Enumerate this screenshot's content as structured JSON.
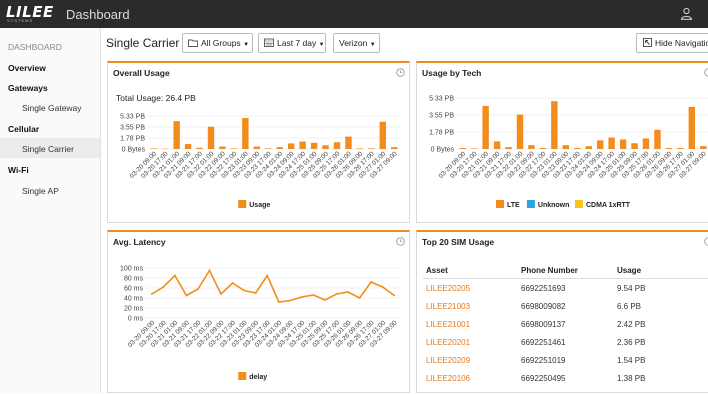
{
  "brand": {
    "logo_text": "LILEE",
    "logo_sub": "SYSTEMS",
    "app_title": "Dashboard"
  },
  "sidebar": {
    "header": "DASHBOARD",
    "items": [
      {
        "label": "Overview",
        "kind": "cat"
      },
      {
        "label": "Gateways",
        "kind": "cat"
      },
      {
        "label": "Single Gateway",
        "kind": "item"
      },
      {
        "label": "Cellular",
        "kind": "cat"
      },
      {
        "label": "Single Carrier",
        "kind": "item",
        "active": true
      },
      {
        "label": "Wi-Fi",
        "kind": "cat"
      },
      {
        "label": "Single AP",
        "kind": "item"
      }
    ]
  },
  "toolbar": {
    "page_title": "Single Carrier",
    "groups": "All Groups",
    "range": "Last 7 day",
    "carrier": "Verizon",
    "hide_nav": "Hide Navigation"
  },
  "colors": {
    "orange": "#f28c1c",
    "blue": "#2aa7e0",
    "yellow": "#f7c51d",
    "accent": "#ef8a20"
  },
  "overall": {
    "title": "Overall Usage",
    "total_label": "Total Usage: 26.4 PB"
  },
  "tech": {
    "title": "Usage by Tech"
  },
  "latency": {
    "title": "Avg. Latency"
  },
  "sims": {
    "title": "Top 20 SIM Usage",
    "columns": [
      "Asset",
      "Phone Number",
      "Usage"
    ],
    "rows": [
      {
        "asset": "LILEE20205",
        "phone": "6692251693",
        "usage": "9.54 PB"
      },
      {
        "asset": "LILEE21003",
        "phone": "6698009082",
        "usage": "6.6 PB"
      },
      {
        "asset": "LILEE21001",
        "phone": "6698009137",
        "usage": "2.42 PB"
      },
      {
        "asset": "LILEE20201",
        "phone": "6692251461",
        "usage": "2.36 PB"
      },
      {
        "asset": "LILEE20209",
        "phone": "6692251019",
        "usage": "1.54 PB"
      },
      {
        "asset": "LILEE20106",
        "phone": "6692250495",
        "usage": "1.38 PB"
      }
    ]
  },
  "chart_data": [
    {
      "type": "bar",
      "categories": [
        "03-20 09:00",
        "03-20 17:00",
        "03-21 01:00",
        "03-21 09:00",
        "03-21 17:00",
        "03-22 01:00",
        "03-22 09:00",
        "03-22 17:00",
        "03-23 01:00",
        "03-23 09:00",
        "03-23 17:00",
        "03-24 01:00",
        "03-24 09:00",
        "03-24 17:00",
        "03-25 01:00",
        "03-25 09:00",
        "03-25 17:00",
        "03-26 01:00",
        "03-26 09:00",
        "03-26 17:00",
        "03-27 01:00",
        "03-27 09:00"
      ],
      "yticks": [
        "0 Bytes",
        "1.78 PB",
        "3.55 PB",
        "5.33 PB"
      ],
      "ylim": [
        0,
        5.33
      ],
      "series": [
        {
          "name": "Usage",
          "color": "#f28c1c",
          "values": [
            0.1,
            0.05,
            4.5,
            0.8,
            0.2,
            3.6,
            0.4,
            0.1,
            5.0,
            0.4,
            0.1,
            0.3,
            0.9,
            1.2,
            1.0,
            0.6,
            1.1,
            2.0,
            0.1,
            0.1,
            4.4,
            0.3
          ]
        }
      ],
      "legend": [
        {
          "name": "Usage",
          "color": "#f28c1c"
        }
      ]
    },
    {
      "type": "bar",
      "categories": [
        "03-20 09:00",
        "03-20 17:00",
        "03-21 01:00",
        "03-21 09:00",
        "03-21 17:00",
        "03-22 01:00",
        "03-22 09:00",
        "03-22 17:00",
        "03-23 01:00",
        "03-23 09:00",
        "03-23 17:00",
        "03-24 01:00",
        "03-24 09:00",
        "03-24 17:00",
        "03-25 01:00",
        "03-25 09:00",
        "03-25 17:00",
        "03-26 01:00",
        "03-26 09:00",
        "03-26 17:00",
        "03-27 01:00",
        "03-27 09:00"
      ],
      "yticks": [
        "0 Bytes",
        "1.78 PB",
        "3.55 PB",
        "5.33 PB"
      ],
      "ylim": [
        0,
        5.33
      ],
      "series": [
        {
          "name": "LTE",
          "color": "#f28c1c",
          "values": [
            0.1,
            0.05,
            4.5,
            0.8,
            0.2,
            3.6,
            0.4,
            0.1,
            5.0,
            0.4,
            0.1,
            0.3,
            0.9,
            1.2,
            1.0,
            0.6,
            1.1,
            2.0,
            0.1,
            0.1,
            4.4,
            0.3
          ]
        },
        {
          "name": "Unknown",
          "color": "#2aa7e0",
          "values": [
            0,
            0,
            0,
            0,
            0,
            0,
            0,
            0,
            0,
            0,
            0,
            0,
            0,
            0,
            0,
            0,
            0,
            0,
            0,
            0,
            0,
            0
          ]
        },
        {
          "name": "CDMA 1xRTT",
          "color": "#f7c51d",
          "values": [
            0,
            0,
            0,
            0,
            0,
            0,
            0,
            0,
            0,
            0,
            0,
            0,
            0,
            0,
            0,
            0,
            0,
            0,
            0,
            0,
            0,
            0
          ]
        }
      ],
      "legend": [
        {
          "name": "LTE",
          "color": "#f28c1c"
        },
        {
          "name": "Unknown",
          "color": "#2aa7e0"
        },
        {
          "name": "CDMA 1xRTT",
          "color": "#f7c51d"
        }
      ]
    },
    {
      "type": "line",
      "categories": [
        "03-20 09:00",
        "03-20 17:00",
        "03-21 01:00",
        "03-21 09:00",
        "03-21 17:00",
        "03-22 01:00",
        "03-22 09:00",
        "03-22 17:00",
        "03-23 01:00",
        "03-23 09:00",
        "03-23 17:00",
        "03-24 01:00",
        "03-24 09:00",
        "03-24 17:00",
        "03-25 01:00",
        "03-25 09:00",
        "03-25 17:00",
        "03-26 01:00",
        "03-26 09:00",
        "03-26 17:00",
        "03-27 01:00",
        "03-27 09:00"
      ],
      "yticks": [
        "0 ms",
        "20 ms",
        "40 ms",
        "60 ms",
        "80 ms",
        "100 ms"
      ],
      "ylim": [
        0,
        100
      ],
      "series": [
        {
          "name": "delay",
          "color": "#f28c1c",
          "values": [
            48,
            62,
            85,
            45,
            58,
            95,
            48,
            70,
            55,
            50,
            85,
            32,
            35,
            42,
            46,
            36,
            48,
            52,
            40,
            72,
            62,
            45
          ]
        }
      ],
      "legend": [
        {
          "name": "delay",
          "color": "#f28c1c"
        }
      ]
    }
  ]
}
